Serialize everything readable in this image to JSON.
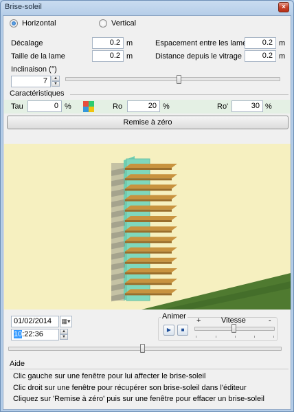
{
  "window": {
    "title": "Brise-soleil",
    "close_label": "×"
  },
  "orientation": {
    "horizontal_label": "Horizontal",
    "vertical_label": "Vertical",
    "selected": "horizontal"
  },
  "params": {
    "decalage": {
      "label": "Décalage",
      "value": "0.2",
      "unit": "m"
    },
    "taille": {
      "label": "Taille de la lame",
      "value": "0.2",
      "unit": "m"
    },
    "espacement": {
      "label": "Espacement entre les lames",
      "value": "0.2",
      "unit": "m"
    },
    "distance": {
      "label": "Distance depuis le vitrage",
      "value": "0.2",
      "unit": "m"
    },
    "inclinaison": {
      "label": "Inclinaison (°)",
      "value": "7",
      "slider_fraction": 0.53
    }
  },
  "characteristics": {
    "heading": "Caractéristiques",
    "tau": {
      "label": "Tau",
      "value": "0",
      "unit": "%"
    },
    "ro": {
      "label": "Ro",
      "value": "20",
      "unit": "%"
    },
    "ro_prime": {
      "label": "Ro'",
      "value": "30",
      "unit": "%"
    },
    "color_icon": "color-palette-icon"
  },
  "reset_label": "Remise à zéro",
  "scene": {
    "wall_color": "#f6f0c0",
    "slat_color": "#c8933f",
    "glass_color": "#7fd8bd",
    "grass_color": "#4f7a30"
  },
  "datetime": {
    "date": "01/02/2014",
    "hour": "10",
    "rest_time": ":22:36",
    "time_slider_fraction": 0.49
  },
  "animate": {
    "heading": "Animer",
    "speed_label": "Vitesse",
    "plus": "+",
    "minus": "-",
    "play_icon": "play-icon",
    "stop_icon": "stop-icon",
    "speed_fraction": 0.49
  },
  "help": {
    "heading": "Aide",
    "lines": [
      "Clic gauche sur une fenêtre pour lui affecter le brise-soleil",
      "Clic droit sur une fenêtre pour récupérer son brise-soleil dans l'éditeur",
      "Cliquez sur 'Remise à zéro' puis sur une fenêtre pour effacer un brise-soleil"
    ]
  }
}
